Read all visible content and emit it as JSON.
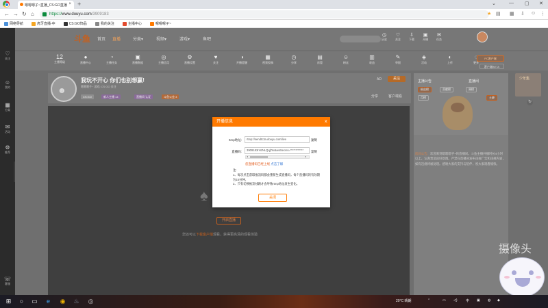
{
  "browser": {
    "tab_title": "嗯嗯嗯子~直播_CS:GO直播",
    "tab_close": "×",
    "new_tab": "+",
    "url_https": "https://",
    "url_host": "www.douyu.com",
    "url_path": "/3909183",
    "bookmarks": [
      {
        "label": "网络导航",
        "color": "#4a90d9"
      },
      {
        "label": "虎牙直播-中",
        "color": "#f5a623"
      },
      {
        "label": "CS:GO饰品",
        "color": "#333333"
      },
      {
        "label": "我的关注",
        "color": "#888888"
      },
      {
        "label": "主播中心",
        "color": "#e24b2e"
      },
      {
        "label": "嗯嗯嗯子~",
        "color": "#ff7a00"
      }
    ]
  },
  "header": {
    "logo": "斗鱼",
    "nav": [
      "首页",
      "直播",
      "分类▾",
      "视频▾",
      "游戏▾",
      "鱼吧"
    ],
    "icons": [
      "历史",
      "关注",
      "下载",
      "开播",
      "任务"
    ]
  },
  "left_nav": [
    "关注",
    "我的",
    "分类",
    "活动",
    "推荐",
    "客服"
  ],
  "toolstrip": [
    {
      "big": "12",
      "label": "主播等级"
    },
    {
      "icon": "●",
      "label": "直播中心"
    },
    {
      "icon": "◔",
      "label": "主播任务"
    },
    {
      "icon": "▣",
      "label": "直播数据"
    },
    {
      "icon": "◎",
      "label": "主播信用"
    },
    {
      "icon": "⚙",
      "label": "直播设置"
    },
    {
      "icon": "♥",
      "label": "关注"
    },
    {
      "icon": "◑",
      "label": "开播提醒"
    },
    {
      "icon": "▦",
      "label": "视频投稿"
    },
    {
      "icon": "◷",
      "label": "分享"
    },
    {
      "icon": "▤",
      "label": "房管"
    },
    {
      "icon": "☺",
      "label": "粉丝"
    },
    {
      "icon": "▥",
      "label": "收益"
    },
    {
      "icon": "✎",
      "label": "举报"
    },
    {
      "icon": "◈",
      "label": "活动"
    },
    {
      "icon": "◐",
      "label": "上传"
    },
    {
      "icon": "◌",
      "label": "更多"
    }
  ],
  "pc_live_button": "PC客户端",
  "beta_button": "客户端BETA",
  "room": {
    "title": "我玩不开心 你们也别想赢!",
    "subtitle": "嗯嗯嗯子~   游戏: CS:GO   关注",
    "chips": [
      {
        "label": "CS:GO",
        "color": "#8f8f8f"
      },
      {
        "label": "新人主播 14",
        "color": "#8a6b9a"
      },
      {
        "label": "直播间 认证",
        "color": "#8a6b9a"
      },
      {
        "label": "斗鱼公会 3",
        "color": "#b36a3a"
      }
    ],
    "right_labels": [
      "AD",
      "分享",
      "客户端看"
    ],
    "fan_button": "关注"
  },
  "player": {
    "open_live": "开启直播",
    "tip_prefix": "您还可以",
    "tip_link": "下载客户端",
    "tip_suffix": "观看，获得更高清的观看体验"
  },
  "right_panel": {
    "tabs": [
      "主播公告",
      "直播间"
    ],
    "chips": [
      "粉丝榜",
      "贡献榜",
      "周榜",
      "月榜",
      "土豪"
    ],
    "notice_header": "房间公告：",
    "notice_text": "欢迎来到嗯嗯嗯子~的直播间。斗鱼主播开播时长4小时以上，认真营造良好氛围。严禁在直播间发布违规广告和违规内容，如有违规将被处理。感谢大家的支持与陪伴，祝大家观看愉快。"
  },
  "thumb_card": "少年集",
  "modal": {
    "title": "开播信息",
    "close": "×",
    "rtmp_label": "rtmp地址:",
    "rtmp_value": "rtmp://sendtc3a.douyu.com/live",
    "rtmp_copy": "复制",
    "code_label": "直播码:",
    "code_value": "3909183rHzNLQqjTsx&wsSecret=************",
    "code_copy": "复制",
    "warn": "您直播码已经上线",
    "more": "点击了解",
    "notes_title": "注:",
    "notes": [
      "1、每次点击获取推流码都会重新生成直播码，每个直播码的有效期为15分钟。",
      "2、只有切换推流线路才会导致rtmp地址发生变化。"
    ],
    "confirm": "关闭"
  },
  "webcam": {
    "title": "摄像头"
  },
  "taskbar": {
    "tray_temp": "20°C 晴朗",
    "tray_lang": "中",
    "time": "",
    "date": ""
  }
}
